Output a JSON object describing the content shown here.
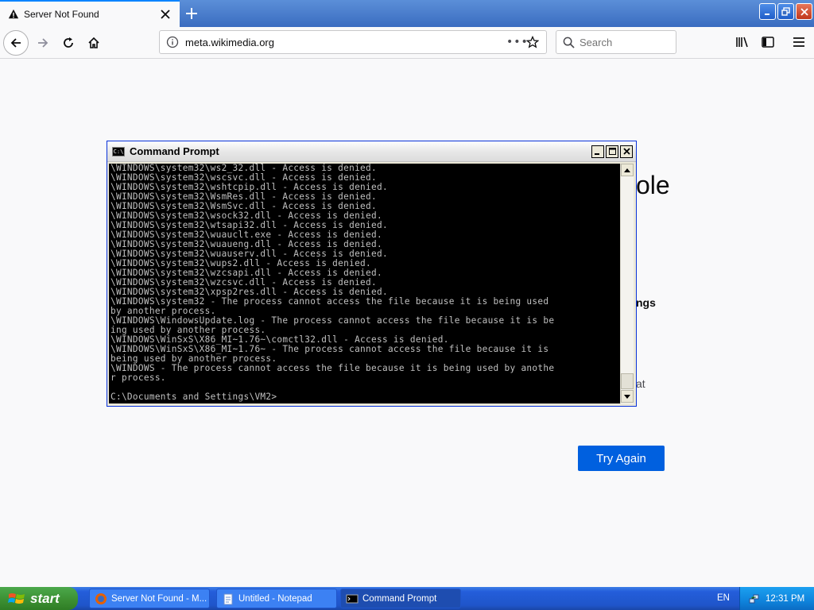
{
  "browser": {
    "tab_title": "Server Not Found",
    "url_host": "meta.wikimedia.org",
    "search_placeholder": "Search"
  },
  "page": {
    "title_fragment": "ole",
    "fragment_mid": "ngs",
    "fragment_low": "at",
    "try_again_label": "Try Again"
  },
  "cmd": {
    "title": "Command Prompt",
    "icon_text": "C:\\",
    "lines": "\\WINDOWS\\system32\\ws2_32.dll - Access is denied.\n\\WINDOWS\\system32\\wscsvc.dll - Access is denied.\n\\WINDOWS\\system32\\wshtcpip.dll - Access is denied.\n\\WINDOWS\\system32\\WsmRes.dll - Access is denied.\n\\WINDOWS\\system32\\WsmSvc.dll - Access is denied.\n\\WINDOWS\\system32\\wsock32.dll - Access is denied.\n\\WINDOWS\\system32\\wtsapi32.dll - Access is denied.\n\\WINDOWS\\system32\\wuauclt.exe - Access is denied.\n\\WINDOWS\\system32\\wuaueng.dll - Access is denied.\n\\WINDOWS\\system32\\wuauserv.dll - Access is denied.\n\\WINDOWS\\system32\\wups2.dll - Access is denied.\n\\WINDOWS\\system32\\wzcsapi.dll - Access is denied.\n\\WINDOWS\\system32\\wzcsvc.dll - Access is denied.\n\\WINDOWS\\system32\\xpsp2res.dll - Access is denied.\n\\WINDOWS\\system32 - The process cannot access the file because it is being used\nby another process.\n\\WINDOWS\\WindowsUpdate.log - The process cannot access the file because it is be\ning used by another process.\n\\WINDOWS\\WinSxS\\X86_MI~1.76~\\comctl32.dll - Access is denied.\n\\WINDOWS\\WinSxS\\X86_MI~1.76~ - The process cannot access the file because it is\nbeing used by another process.\n\\WINDOWS - The process cannot access the file because it is being used by anothe\nr process.\n\nC:\\Documents and Settings\\VM2>"
  },
  "taskbar": {
    "start_label": "start",
    "tasks": [
      {
        "label": "Server Not Found - M..."
      },
      {
        "label": "Untitled - Notepad"
      },
      {
        "label": "Command Prompt"
      }
    ],
    "language": "EN",
    "clock": "12:31 PM"
  },
  "colors": {
    "accent": "#0060df",
    "tab_highlight": "#0a84ff",
    "xp_blue": "#245edb",
    "start_green": "#3b8e31"
  }
}
